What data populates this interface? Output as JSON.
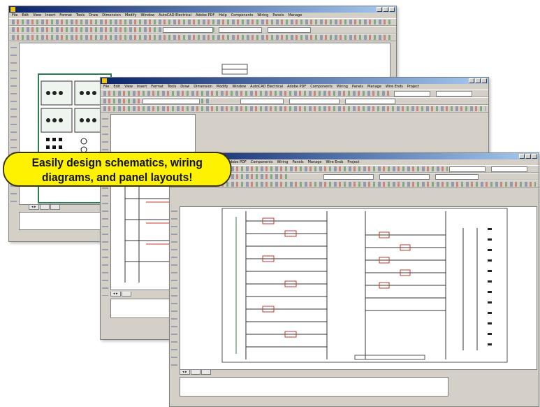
{
  "callout": {
    "line1": "Easily design schematics, wiring",
    "line2": "diagrams, and panel layouts!"
  },
  "menu": [
    "File",
    "Edit",
    "View",
    "Insert",
    "Format",
    "Tools",
    "Draw",
    "Dimension",
    "Modify",
    "Window",
    "AutoCAD Electrical",
    "Adobe PDF",
    "Help",
    "Components",
    "Wiring",
    "Panels",
    "Manage",
    "Wire Ends",
    "Project"
  ],
  "windows": [
    {
      "name": "back"
    },
    {
      "name": "middle"
    },
    {
      "name": "front"
    }
  ],
  "icons": {
    "maximize": "maximize-icon",
    "minimize": "minimize-icon",
    "close": "close-icon"
  },
  "colors": {
    "title_start": "#0a246a",
    "title_end": "#a6caf0",
    "callout_fill": "#fff200",
    "schematic_red": "#c0392b",
    "panel_green": "#2e7d4f"
  }
}
